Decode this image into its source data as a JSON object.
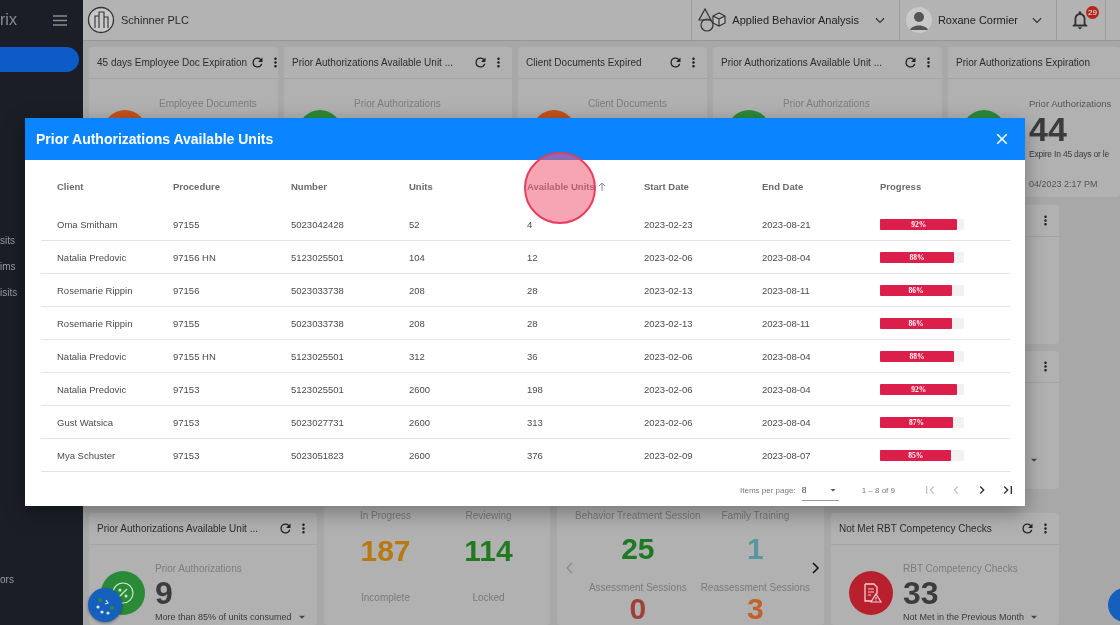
{
  "sidebar": {
    "brand": "rix",
    "items": [
      {
        "label": "sits"
      },
      {
        "label": "ims"
      },
      {
        "label": "isits"
      }
    ],
    "bottom_items": [
      {
        "label": "ors"
      }
    ]
  },
  "topbar": {
    "company": "Schinner PLC",
    "program": "Applied Behavior Analysis",
    "user": "Roxane Cormier",
    "notification_count": "29"
  },
  "top_widgets": [
    {
      "title": "45 days Employee Doc Expiration",
      "label": "Employee Documents",
      "color": "#c4521c",
      "actions": true
    },
    {
      "title": "Prior Authorizations Available Unit ...",
      "label": "Prior Authorizations",
      "color": "#2a8a38",
      "actions": true
    },
    {
      "title": "Client Documents Expired",
      "label": "Client Documents",
      "color": "#c4521c",
      "actions": true
    },
    {
      "title": "Prior Authorizations Available Unit ...",
      "label": "Prior Authorizations",
      "color": "#2a8a38",
      "actions": true
    },
    {
      "title": "Prior Authorizations Expiration",
      "label": "Prior Authorizations",
      "color": "#2a8a38",
      "actions": false,
      "value": "44",
      "description": "Expire In 45 days or le",
      "updated": "04/2023 2:17 PM"
    }
  ],
  "auth_widget": {
    "title": "Prior Authorizations Available Unit ...",
    "label": "Prior Authorizations",
    "value": "9",
    "description": "More than 85% of units consumed",
    "color": "#2a8a38"
  },
  "status_widget": {
    "stats": [
      {
        "label": "In Progress",
        "value": "187",
        "color": "#b87a10"
      },
      {
        "label": "Reviewing",
        "value": "114",
        "color": "#217a21"
      },
      {
        "label": "Incomplete"
      },
      {
        "label": "Locked"
      }
    ]
  },
  "session_widget": {
    "stats": [
      {
        "label": "Behavior Treatment Session",
        "value": "25",
        "color": "#1c7a24"
      },
      {
        "label": "Family Training",
        "value": "1",
        "color": "#5b95a0"
      },
      {
        "label": "Assessment Sessions",
        "value": "0",
        "color": "#9c4038"
      },
      {
        "label": "Reassessment Sessions",
        "value": "3",
        "color": "#c2622a"
      }
    ]
  },
  "rbt_widget": {
    "title": "Not Met RBT Competency Checks",
    "label": "RBT Competency Checks",
    "value": "33",
    "description": "Not Met in the Previous Month",
    "color": "#b8202e"
  },
  "modal": {
    "title": "Prior Authorizations Available Units",
    "columns": [
      {
        "label": "Client",
        "sorted": false
      },
      {
        "label": "Procedure",
        "sorted": false
      },
      {
        "label": "Number",
        "sorted": false
      },
      {
        "label": "Units",
        "sorted": false
      },
      {
        "label": "Available Units",
        "sorted": true
      },
      {
        "label": "Start Date",
        "sorted": false
      },
      {
        "label": "End Date",
        "sorted": false
      },
      {
        "label": "Progress",
        "sorted": false
      }
    ],
    "rows": [
      {
        "client": "Oma Smitham",
        "procedure": "97155",
        "number": "5023042428",
        "units": "52",
        "available_units": "4",
        "start_date": "2023-02-23",
        "end_date": "2023-08-21",
        "progress": "92%",
        "level": 0.92
      },
      {
        "client": "Natalia Predovic",
        "procedure": "97156 HN",
        "number": "5123025501",
        "units": "104",
        "available_units": "12",
        "start_date": "2023-02-06",
        "end_date": "2023-08-04",
        "progress": "88%",
        "level": 0.88
      },
      {
        "client": "Rosemarie Rippin",
        "procedure": "97156",
        "number": "5023033738",
        "units": "208",
        "available_units": "28",
        "start_date": "2023-02-13",
        "end_date": "2023-08-11",
        "progress": "86%",
        "level": 0.86
      },
      {
        "client": "Rosemarie Rippin",
        "procedure": "97155",
        "number": "5023033738",
        "units": "208",
        "available_units": "28",
        "start_date": "2023-02-13",
        "end_date": "2023-08-11",
        "progress": "86%",
        "level": 0.86
      },
      {
        "client": "Natalia Predovic",
        "procedure": "97155 HN",
        "number": "5123025501",
        "units": "312",
        "available_units": "36",
        "start_date": "2023-02-06",
        "end_date": "2023-08-04",
        "progress": "88%",
        "level": 0.88
      },
      {
        "client": "Natalia Predovic",
        "procedure": "97153",
        "number": "5123025501",
        "units": "2600",
        "available_units": "198",
        "start_date": "2023-02-06",
        "end_date": "2023-08-04",
        "progress": "92%",
        "level": 0.92
      },
      {
        "client": "Gust Watsica",
        "procedure": "97153",
        "number": "5023027731",
        "units": "2600",
        "available_units": "313",
        "start_date": "2023-02-06",
        "end_date": "2023-08-04",
        "progress": "87%",
        "level": 0.87
      },
      {
        "client": "Mya Schuster",
        "procedure": "97153",
        "number": "5023051823",
        "units": "2600",
        "available_units": "376",
        "start_date": "2023-02-09",
        "end_date": "2023-08-07",
        "progress": "85%",
        "level": 0.85
      }
    ],
    "paginator": {
      "items_per_page_label": "Items per page:",
      "page_size": "8",
      "range": "1 – 8 of 9",
      "buttons": [
        {
          "kind": "first",
          "disabled": true
        },
        {
          "kind": "previous",
          "disabled": true
        },
        {
          "kind": "next",
          "disabled": false
        },
        {
          "kind": "last",
          "disabled": false
        }
      ]
    }
  }
}
